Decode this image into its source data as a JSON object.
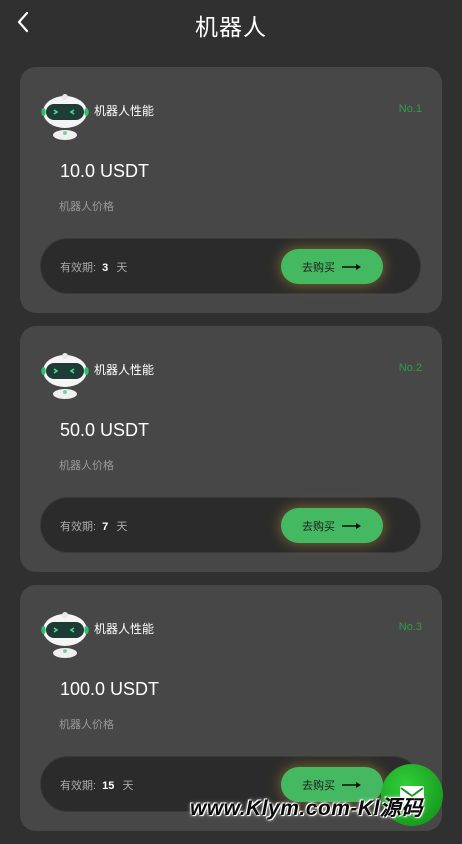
{
  "header": {
    "title": "机器人"
  },
  "robots": [
    {
      "label": "机器人性能",
      "no": "No.1",
      "price": "10.0 USDT",
      "price_label": "机器人价格",
      "validity_label": "有效期:",
      "days": "3",
      "days_unit": "天",
      "buy_label": "去购买"
    },
    {
      "label": "机器人性能",
      "no": "No.2",
      "price": "50.0 USDT",
      "price_label": "机器人价格",
      "validity_label": "有效期:",
      "days": "7",
      "days_unit": "天",
      "buy_label": "去购买"
    },
    {
      "label": "机器人性能",
      "no": "No.3",
      "price": "100.0 USDT",
      "price_label": "机器人价格",
      "validity_label": "有效期:",
      "days": "15",
      "days_unit": "天",
      "buy_label": "去购买"
    }
  ],
  "watermark": "www.Klym.com-Kl源码",
  "colors": {
    "background": "#303030",
    "card": "#474747",
    "accent_green": "#45b862",
    "no_text": "#2f9e45"
  },
  "icons": {
    "back": "chevron-left-icon",
    "robot": "robot-avatar-icon",
    "arrow": "arrow-right-icon",
    "mail": "mail-icon"
  }
}
